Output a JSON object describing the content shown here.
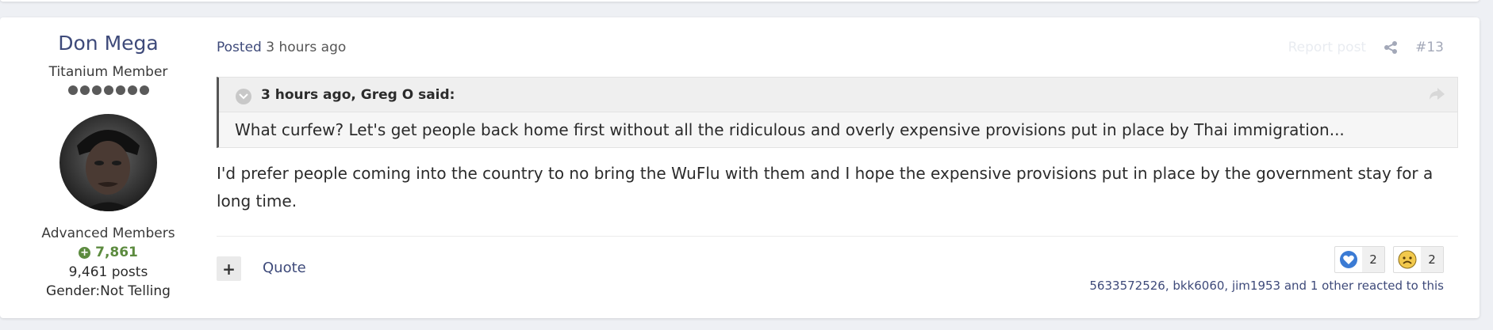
{
  "author": {
    "name": "Don Mega",
    "title": "Titanium Member",
    "rank_pips": 7,
    "group": "Advanced Members",
    "reputation": "7,861",
    "posts": "9,461 posts",
    "gender": "Gender:Not Telling"
  },
  "meta": {
    "posted_prefix": "Posted",
    "posted_time": "3 hours ago",
    "report_label": "Report post",
    "post_number": "#13"
  },
  "quote": {
    "citation": "3 hours ago, Greg O said:",
    "text": "What curfew? Let's get people back home first without all the ridiculous and overly expensive provisions put in place by Thai immigration..."
  },
  "content": {
    "body": "I'd prefer people coming into the country to no bring the WuFlu with them and I hope the expensive provisions put in place by the government stay for a long time."
  },
  "actions": {
    "plus_label": "+",
    "quote_label": "Quote"
  },
  "reactions": {
    "items": [
      {
        "icon": "like-heart-icon",
        "count": "2",
        "color": "#3b7bd4"
      },
      {
        "icon": "sad-face-icon",
        "count": "2",
        "color": "#f2c94c"
      }
    ],
    "summary": "5633572526, bkk6060, jim1953 and 1 other reacted to this"
  },
  "colors": {
    "link": "#3e4a7a",
    "reputation": "#5c8b3f",
    "quote_border": "#555555"
  }
}
